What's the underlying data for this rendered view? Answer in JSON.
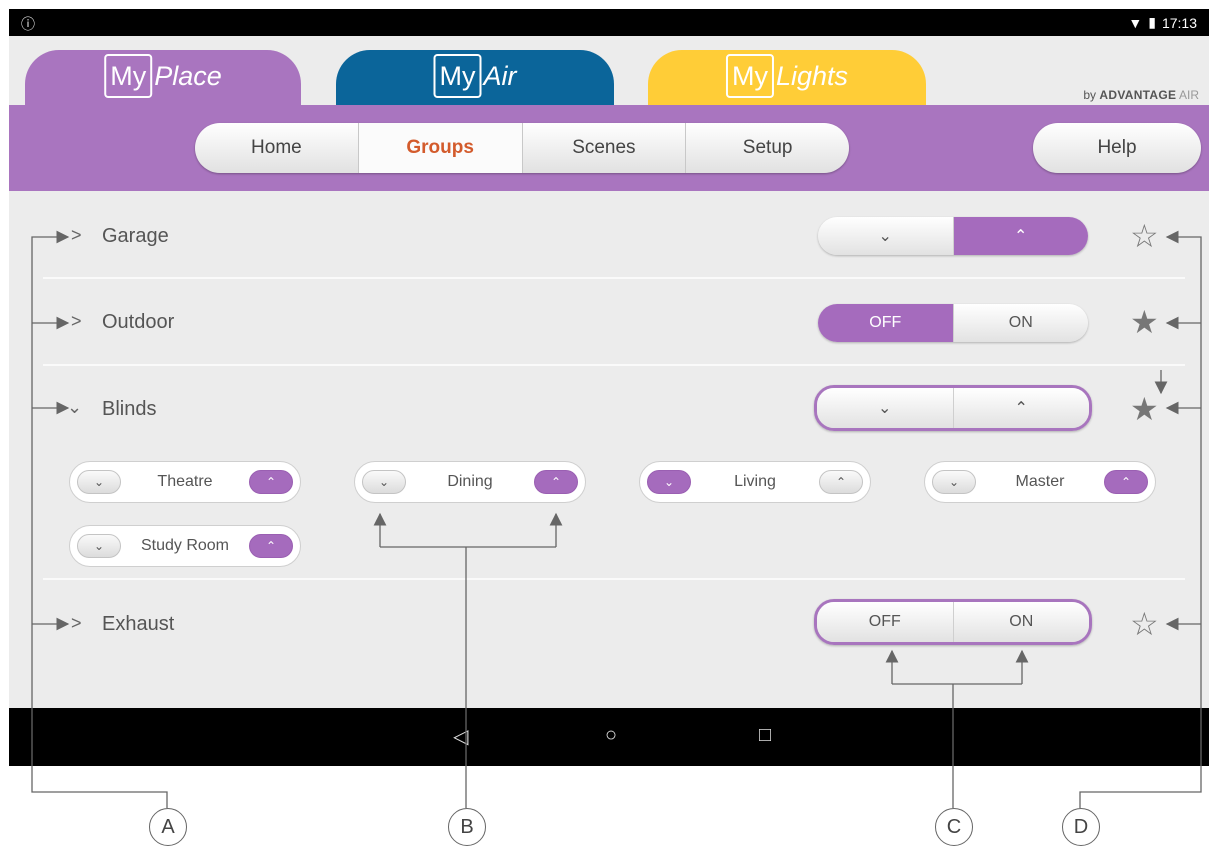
{
  "status_bar": {
    "info_icon": "info-icon",
    "time": "17:13"
  },
  "app_tabs": [
    {
      "prefix": "My",
      "name": "Place",
      "color": "#a975bf"
    },
    {
      "prefix": "My",
      "name": "Air",
      "color": "#0b659a"
    },
    {
      "prefix": "My",
      "name": "Lights",
      "color": "#ffcd37"
    }
  ],
  "brand": {
    "by": "by",
    "name": "ADVANTAGE",
    "suffix": "AIR"
  },
  "nav": {
    "home": "Home",
    "groups": "Groups",
    "scenes": "Scenes",
    "setup": "Setup",
    "help": "Help",
    "active": "Groups"
  },
  "groups": {
    "garage": {
      "label": "Garage",
      "chevron": ">",
      "down": "⌄",
      "up": "⌃",
      "favourite": false
    },
    "outdoor": {
      "label": "Outdoor",
      "chevron": ">",
      "off": "OFF",
      "on": "ON",
      "favourite": true
    },
    "blinds": {
      "label": "Blinds",
      "chevron": "⌄",
      "down": "⌄",
      "up": "⌃",
      "favourite": true
    },
    "exhaust": {
      "label": "Exhaust",
      "chevron": ">",
      "off": "OFF",
      "on": "ON",
      "favourite": false
    }
  },
  "blinds_items": [
    {
      "label": "Theatre",
      "down": "⌄",
      "up": "⌃",
      "active": "up"
    },
    {
      "label": "Dining",
      "down": "⌄",
      "up": "⌃",
      "active": "up"
    },
    {
      "label": "Living",
      "down": "⌄",
      "up": "⌃",
      "active": "down"
    },
    {
      "label": "Master",
      "down": "⌄",
      "up": "⌃",
      "active": "up"
    },
    {
      "label": "Study Room",
      "down": "⌄",
      "up": "⌃",
      "active": "up"
    }
  ],
  "android_nav": {
    "back": "◁",
    "home": "○",
    "recents": "□"
  },
  "callouts": {
    "a": "A",
    "b": "B",
    "c": "C",
    "d": "D"
  },
  "colors": {
    "accent": "#a975bf",
    "active_text": "#d35b2c",
    "air": "#0b659a",
    "lights": "#ffcd37"
  }
}
